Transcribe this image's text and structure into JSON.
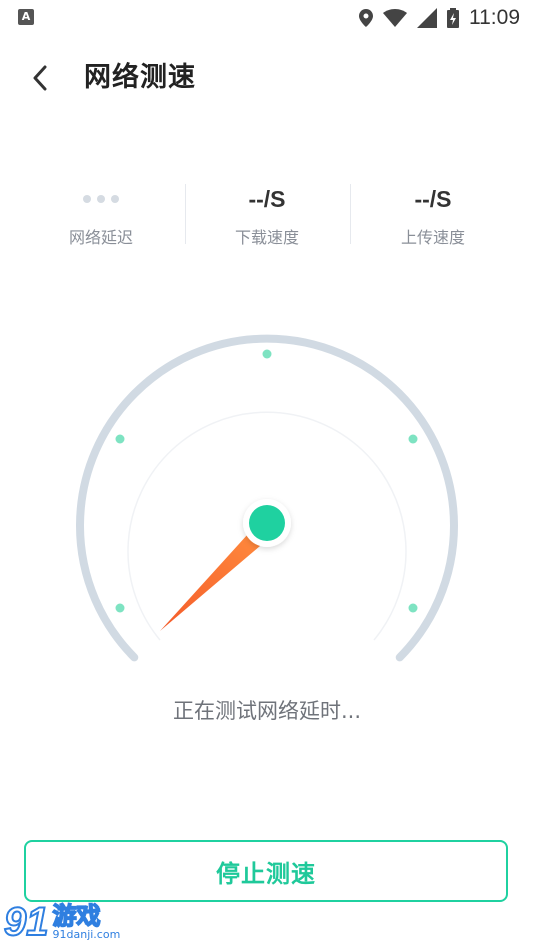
{
  "status_bar": {
    "left_icon_letter": "A",
    "time": "11:09",
    "icons": [
      "location-icon",
      "wifi-icon",
      "signal-icon",
      "battery-icon"
    ]
  },
  "app_bar": {
    "back_icon": "chevron-left-icon",
    "title": "网络测速"
  },
  "metrics": {
    "latency": {
      "value_icon": "loading-dots-icon",
      "label": "网络延迟"
    },
    "download": {
      "value": "--/S",
      "label": "下载速度"
    },
    "upload": {
      "value": "--/S",
      "label": "上传速度"
    }
  },
  "gauge": {
    "needle_level": 0,
    "colors": {
      "arc": "#d1dae3",
      "tick_dot": "#7ee3c2",
      "hub": "#1fd1a0",
      "needle_start": "#f45b2a",
      "needle_end": "#ff8a3d"
    }
  },
  "status_text": "正在测试网络延时...",
  "stop_button": {
    "label": "停止测速"
  },
  "watermark": {
    "number": "91",
    "name": "游戏",
    "url": "91danji.com"
  },
  "accent_color": "#1fd1a0"
}
